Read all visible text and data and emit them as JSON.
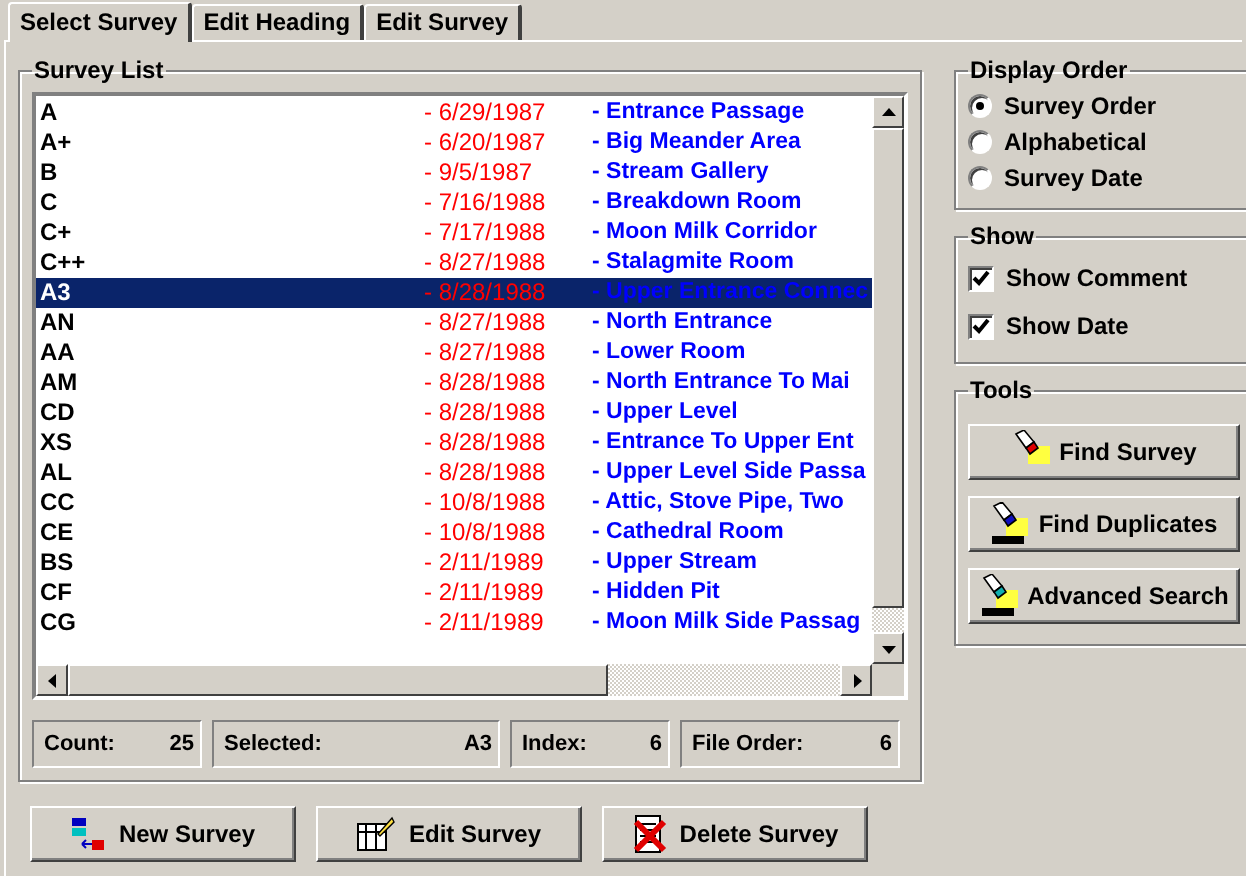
{
  "tabs": [
    {
      "label": "Select Survey",
      "selected": true
    },
    {
      "label": "Edit Heading",
      "selected": false
    },
    {
      "label": "Edit Survey",
      "selected": false
    }
  ],
  "survey_list": {
    "title": "Survey List",
    "rows": [
      {
        "name": "A",
        "date": "- 6/29/1987",
        "comment": "- Entrance Passage",
        "selected": false
      },
      {
        "name": "A+",
        "date": "- 6/20/1987",
        "comment": "- Big Meander Area",
        "selected": false
      },
      {
        "name": "B",
        "date": "- 9/5/1987",
        "comment": "- Stream Gallery",
        "selected": false
      },
      {
        "name": "C",
        "date": "- 7/16/1988",
        "comment": "- Breakdown Room",
        "selected": false
      },
      {
        "name": "C+",
        "date": "- 7/17/1988",
        "comment": "- Moon Milk Corridor",
        "selected": false
      },
      {
        "name": "C++",
        "date": "- 8/27/1988",
        "comment": "- Stalagmite Room",
        "selected": false
      },
      {
        "name": "A3",
        "date": "- 8/28/1988",
        "comment": "- Upper Entrance Connec",
        "selected": true
      },
      {
        "name": "AN",
        "date": "- 8/27/1988",
        "comment": "- North Entrance",
        "selected": false
      },
      {
        "name": "AA",
        "date": "- 8/27/1988",
        "comment": "- Lower Room",
        "selected": false
      },
      {
        "name": "AM",
        "date": "- 8/28/1988",
        "comment": "- North Entrance To Mai",
        "selected": false
      },
      {
        "name": "CD",
        "date": "- 8/28/1988",
        "comment": "- Upper Level",
        "selected": false
      },
      {
        "name": "XS",
        "date": "- 8/28/1988",
        "comment": "- Entrance To Upper Ent",
        "selected": false
      },
      {
        "name": "AL",
        "date": "- 8/28/1988",
        "comment": "- Upper Level Side Passa",
        "selected": false
      },
      {
        "name": "CC",
        "date": "- 10/8/1988",
        "comment": "- Attic, Stove Pipe, Two",
        "selected": false
      },
      {
        "name": "CE",
        "date": "- 10/8/1988",
        "comment": "- Cathedral Room",
        "selected": false
      },
      {
        "name": "BS",
        "date": "- 2/11/1989",
        "comment": "- Upper Stream",
        "selected": false
      },
      {
        "name": "CF",
        "date": "- 2/11/1989",
        "comment": "- Hidden Pit",
        "selected": false
      },
      {
        "name": "CG",
        "date": "- 2/11/1989",
        "comment": "- Moon Milk Side Passag",
        "selected": false
      }
    ],
    "status": [
      {
        "label": "Count:",
        "value": "25"
      },
      {
        "label": "Selected:",
        "value": "A3"
      },
      {
        "label": "Index:",
        "value": "6"
      },
      {
        "label": "File Order:",
        "value": "6"
      }
    ]
  },
  "display_order": {
    "title": "Display Order",
    "options": [
      {
        "label": "Survey Order",
        "selected": true
      },
      {
        "label": "Alphabetical",
        "selected": false
      },
      {
        "label": "Survey Date",
        "selected": false
      }
    ]
  },
  "show": {
    "title": "Show",
    "options": [
      {
        "label": "Show Comment",
        "checked": true
      },
      {
        "label": "Show Date",
        "checked": true
      }
    ]
  },
  "tools": {
    "title": "Tools",
    "buttons": [
      {
        "label": "Find Survey",
        "kind": "find"
      },
      {
        "label": "Find Duplicates",
        "kind": "duplicates"
      },
      {
        "label": "Advanced Search",
        "kind": "advanced"
      }
    ]
  },
  "buttons": [
    {
      "label": "New Survey",
      "kind": "new"
    },
    {
      "label": "Edit Survey",
      "kind": "edit"
    },
    {
      "label": "Delete Survey",
      "kind": "delete"
    }
  ]
}
